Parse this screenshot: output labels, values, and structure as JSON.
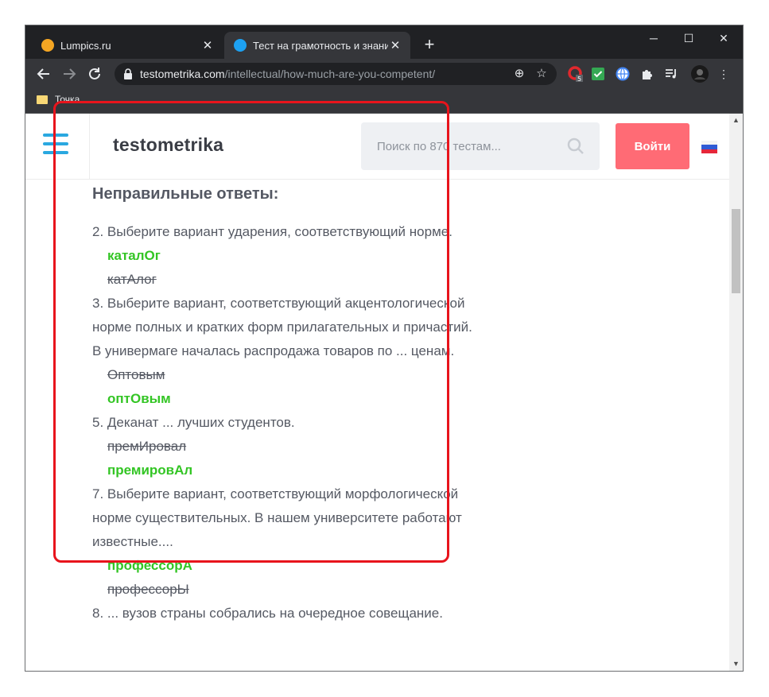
{
  "browser": {
    "tabs": [
      {
        "title": "Lumpics.ru",
        "active": false,
        "favicon_color": "#f5a623"
      },
      {
        "title": "Тест на грамотность и знание р",
        "active": true,
        "favicon_color": "#1da1f2"
      }
    ],
    "new_tab_label": "+",
    "window_controls": {
      "minimize": "─",
      "maximize": "☐",
      "close": "✕"
    },
    "address": {
      "host": "testometrika.com",
      "path": "/intellectual/how-much-are-you-competent/"
    },
    "extensions": [
      {
        "name": "opera-extension-icon",
        "badge": "5",
        "color": "#e0282d"
      },
      {
        "name": "checkmark-extension-icon",
        "color": "#34a853"
      },
      {
        "name": "globe-extension-icon",
        "color": "#4285f4"
      },
      {
        "name": "puzzle-icon",
        "color": "#e8eaed"
      },
      {
        "name": "playlist-icon",
        "color": "#e8eaed"
      }
    ],
    "bookmarks": [
      {
        "label": "Точка"
      }
    ]
  },
  "site": {
    "logo": "testometrika",
    "search_placeholder": "Поиск по 870 тестам...",
    "login_label": "Войти",
    "accent_color": "#ff6b75",
    "menu_color": "#2aa8e0"
  },
  "results": {
    "title": "Неправильные ответы:",
    "items": [
      {
        "question": "2. Выберите вариант ударения, соответствующий норме.",
        "answers": [
          {
            "text": "каталОг",
            "status": "correct"
          },
          {
            "text": "катАлог",
            "status": "wrong"
          }
        ]
      },
      {
        "question": "3. Выберите вариант, соответствующий акцентологической норме полных и кратких форм прилагательных и причастий. В универмаге началась распродажа товаров по ... ценам.",
        "answers": [
          {
            "text": "Оптовым",
            "status": "wrong"
          },
          {
            "text": "оптОвым",
            "status": "correct"
          }
        ]
      },
      {
        "question": "5. Деканат ... лучших студентов.",
        "answers": [
          {
            "text": "премИровал",
            "status": "wrong"
          },
          {
            "text": "премировАл",
            "status": "correct"
          }
        ]
      },
      {
        "question": "7. Выберите вариант, соответствующий морфологической норме существительных. В нашем университете работают известные....",
        "answers": [
          {
            "text": "профессорА",
            "status": "correct"
          },
          {
            "text": "профессорЫ",
            "status": "wrong"
          }
        ]
      },
      {
        "question": "8. ... вузов страны собрались на очередное совещание.",
        "answers": []
      }
    ],
    "correct_color": "#33c524",
    "highlight_color": "#e8141c"
  }
}
